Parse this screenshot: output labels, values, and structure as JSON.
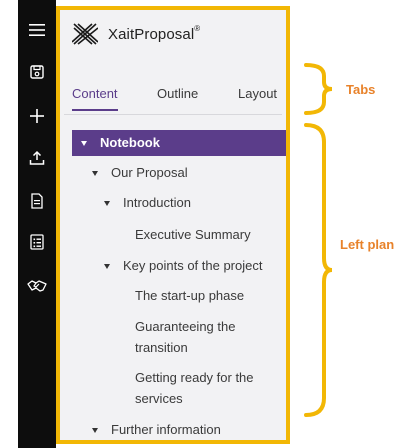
{
  "sidebar_rail": {
    "icons": [
      "menu-icon",
      "save-icon",
      "add-icon",
      "upload-icon",
      "document-icon",
      "checklist-icon",
      "handshake-icon"
    ]
  },
  "app": {
    "name": "XaitProposal",
    "trademark": "®"
  },
  "tabs": [
    {
      "label": "Content",
      "active": true
    },
    {
      "label": "Outline",
      "active": false
    },
    {
      "label": "Layout",
      "active": false
    }
  ],
  "tree": {
    "root": "Notebook",
    "items": [
      {
        "label": "Our Proposal",
        "level": 1,
        "expanded": true
      },
      {
        "label": "Introduction",
        "level": 2,
        "expanded": true
      },
      {
        "label": "Executive Summary",
        "level": 3
      },
      {
        "label": "Key points of the project",
        "level": 2,
        "expanded": true
      },
      {
        "label": "The start-up phase",
        "level": 3
      },
      {
        "label": "Guaranteeing the",
        "level": 3
      },
      {
        "label": "transition",
        "level": 3
      },
      {
        "label": "Getting ready for the",
        "level": 3
      },
      {
        "label": "services",
        "level": 3
      },
      {
        "label": "Further information",
        "level": 1,
        "expanded": true
      }
    ]
  },
  "annotations": {
    "tabs": "Tabs",
    "left_plan": "Left plan"
  },
  "colors": {
    "accent": "#5b3d8a",
    "highlight_border": "#f2b705",
    "annotation": "#e8822a",
    "rail": "#0d0d0d"
  }
}
